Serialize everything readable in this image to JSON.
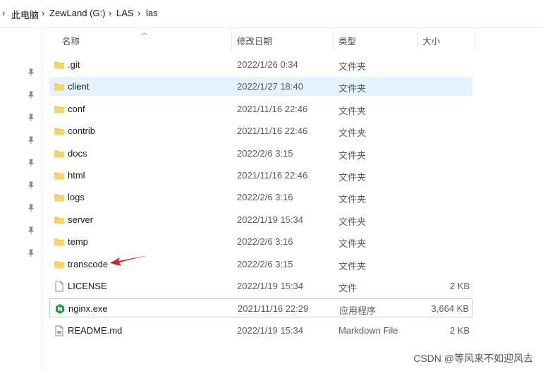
{
  "breadcrumb": {
    "items": [
      "此电脑",
      "ZewLand (G:)",
      "LAS",
      "las"
    ],
    "separator": "›"
  },
  "columns": {
    "name": "名称",
    "modified": "修改日期",
    "type": "类型",
    "size": "大小"
  },
  "files": [
    {
      "name": ".git",
      "modified": "2022/1/26 0:34",
      "type": "文件夹",
      "size": "",
      "icon": "folder-icon"
    },
    {
      "name": "client",
      "modified": "2022/1/27 18:40",
      "type": "文件夹",
      "size": "",
      "icon": "folder-icon"
    },
    {
      "name": "conf",
      "modified": "2021/11/16 22:46",
      "type": "文件夹",
      "size": "",
      "icon": "folder-icon"
    },
    {
      "name": "contrib",
      "modified": "2021/11/16 22:46",
      "type": "文件夹",
      "size": "",
      "icon": "folder-icon"
    },
    {
      "name": "docs",
      "modified": "2022/2/6 3:15",
      "type": "文件夹",
      "size": "",
      "icon": "folder-icon"
    },
    {
      "name": "html",
      "modified": "2021/11/16 22:46",
      "type": "文件夹",
      "size": "",
      "icon": "folder-icon"
    },
    {
      "name": "logs",
      "modified": "2022/2/6 3:16",
      "type": "文件夹",
      "size": "",
      "icon": "folder-icon"
    },
    {
      "name": "server",
      "modified": "2022/1/19 15:34",
      "type": "文件夹",
      "size": "",
      "icon": "folder-icon"
    },
    {
      "name": "temp",
      "modified": "2022/2/6 3:16",
      "type": "文件夹",
      "size": "",
      "icon": "folder-icon"
    },
    {
      "name": "transcode",
      "modified": "2022/2/6 3:15",
      "type": "文件夹",
      "size": "",
      "icon": "folder-icon"
    },
    {
      "name": "LICENSE",
      "modified": "2022/1/19 15:34",
      "type": "文件",
      "size": "2 KB",
      "icon": "file-icon"
    },
    {
      "name": "nginx.exe",
      "modified": "2021/11/16 22:29",
      "type": "应用程序",
      "size": "3,664 KB",
      "icon": "nginx-icon"
    },
    {
      "name": "README.md",
      "modified": "2022/1/19 15:34",
      "type": "Markdown File",
      "size": "2 KB",
      "icon": "markdown-file-icon"
    }
  ],
  "selected_row": "client",
  "focused_row": "nginx.exe",
  "annotation_arrow_target": "transcode",
  "watermark": "CSDN @等风来不如迎风去",
  "colors": {
    "folder": "#f8c64a",
    "selection": "#e5f3ff",
    "focus_border": "#99d1ff",
    "arrow": "#e02020",
    "nginx": "#1f9c3b"
  }
}
